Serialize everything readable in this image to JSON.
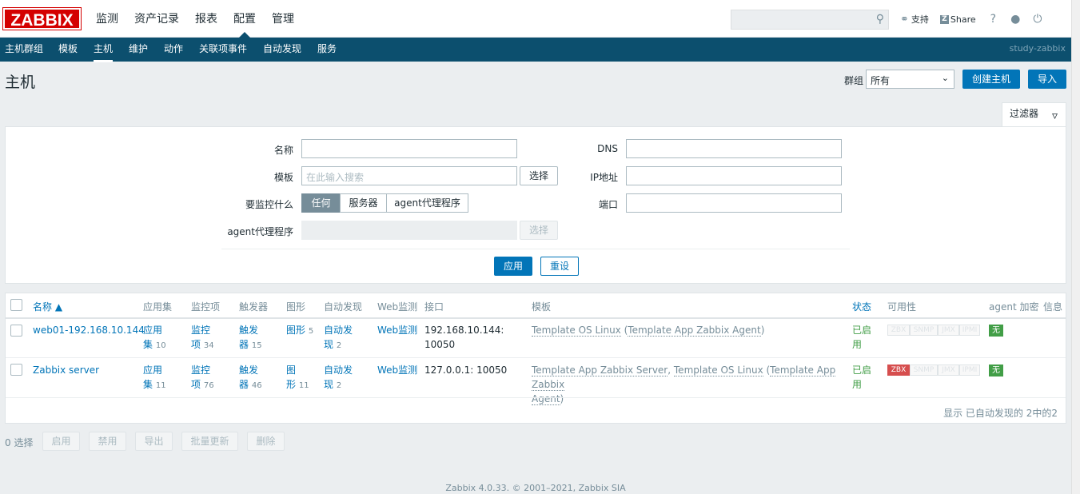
{
  "logo": "ZABBIX",
  "main_menu": [
    "监测",
    "资产记录",
    "报表",
    "配置",
    "管理"
  ],
  "top_links": {
    "support": "支持",
    "share": "Share",
    "help": "?"
  },
  "sub_menu": [
    "主机群组",
    "模板",
    "主机",
    "维护",
    "动作",
    "关联项事件",
    "自动发现",
    "服务"
  ],
  "server_name": "study-zabbix",
  "page_title": "主机",
  "header": {
    "group_label": "群组",
    "group_value": "所有",
    "create_host": "创建主机",
    "import": "导入"
  },
  "filter": {
    "tab_label": "过滤器",
    "name_label": "名称",
    "template_label": "模板",
    "template_placeholder": "在此输入搜索",
    "select": "选择",
    "monitor_label": "要监控什么",
    "monitor_options": [
      "任何",
      "服务器",
      "agent代理程序"
    ],
    "proxy_label": "agent代理程序",
    "dns_label": "DNS",
    "ip_label": "IP地址",
    "port_label": "端口",
    "apply": "应用",
    "reset": "重设"
  },
  "table": {
    "headers": {
      "name": "名称 ▲",
      "apps": "应用集",
      "items": "监控项",
      "triggers": "触发器",
      "graphs": "图形",
      "discovery": "自动发现",
      "web": "Web监测",
      "interface": "接口",
      "templates": "模板",
      "status": "状态",
      "availability": "可用性",
      "encryption": "agent 加密",
      "info": "信息"
    },
    "rows": [
      {
        "name": "web01-192.168.10.144",
        "apps_a": "应用",
        "apps_b": "集",
        "apps_count": "10",
        "items_a": "监控",
        "items_b": "项",
        "items_count": "34",
        "triggers_a": "触发",
        "triggers_b": "器",
        "triggers_count": "15",
        "graphs_a": "图形",
        "graphs_count": "5",
        "disc_a": "自动发",
        "disc_b": "现",
        "disc_count": "2",
        "web": "Web监测",
        "iface_a": "192.168.10.144:",
        "iface_b": "10050",
        "tpl_1": "Template OS Linux",
        "tpl_2": "Template App Zabbix Agent",
        "status_a": "已启",
        "status_b": "用",
        "encryption": "无"
      },
      {
        "name": "Zabbix server",
        "apps_a": "应用",
        "apps_b": "集",
        "apps_count": "11",
        "items_a": "监控",
        "items_b": "项",
        "items_count": "76",
        "triggers_a": "触发",
        "triggers_b": "器",
        "triggers_count": "46",
        "graphs_a": "图",
        "graphs_b": "形",
        "graphs_count": "11",
        "disc_a": "自动发",
        "disc_b": "现",
        "disc_count": "2",
        "web": "Web监测",
        "iface": "127.0.0.1: 10050",
        "tpl_1": "Template App Zabbix Server",
        "tpl_2": "Template OS Linux",
        "tpl_3a": "Template App Zabbix",
        "tpl_3b": "Agent",
        "status_a": "已启",
        "status_b": "用",
        "encryption": "无"
      }
    ],
    "availability_badges": [
      "ZBX",
      "SNMP",
      "JMX",
      "IPMI"
    ],
    "footer": "显示 已自动发现的 2中的2"
  },
  "actions": {
    "selected": "0 选择",
    "buttons": [
      "启用",
      "禁用",
      "导出",
      "批量更新",
      "删除"
    ]
  },
  "copyright": "Zabbix 4.0.33. © 2001–2021, Zabbix SIA",
  "colors": {
    "brand_red": "#d40000",
    "nav_blue": "#0c4f6e",
    "link_blue": "#0275b8",
    "ok_green": "#429e47",
    "error_red": "#d64e4e"
  }
}
